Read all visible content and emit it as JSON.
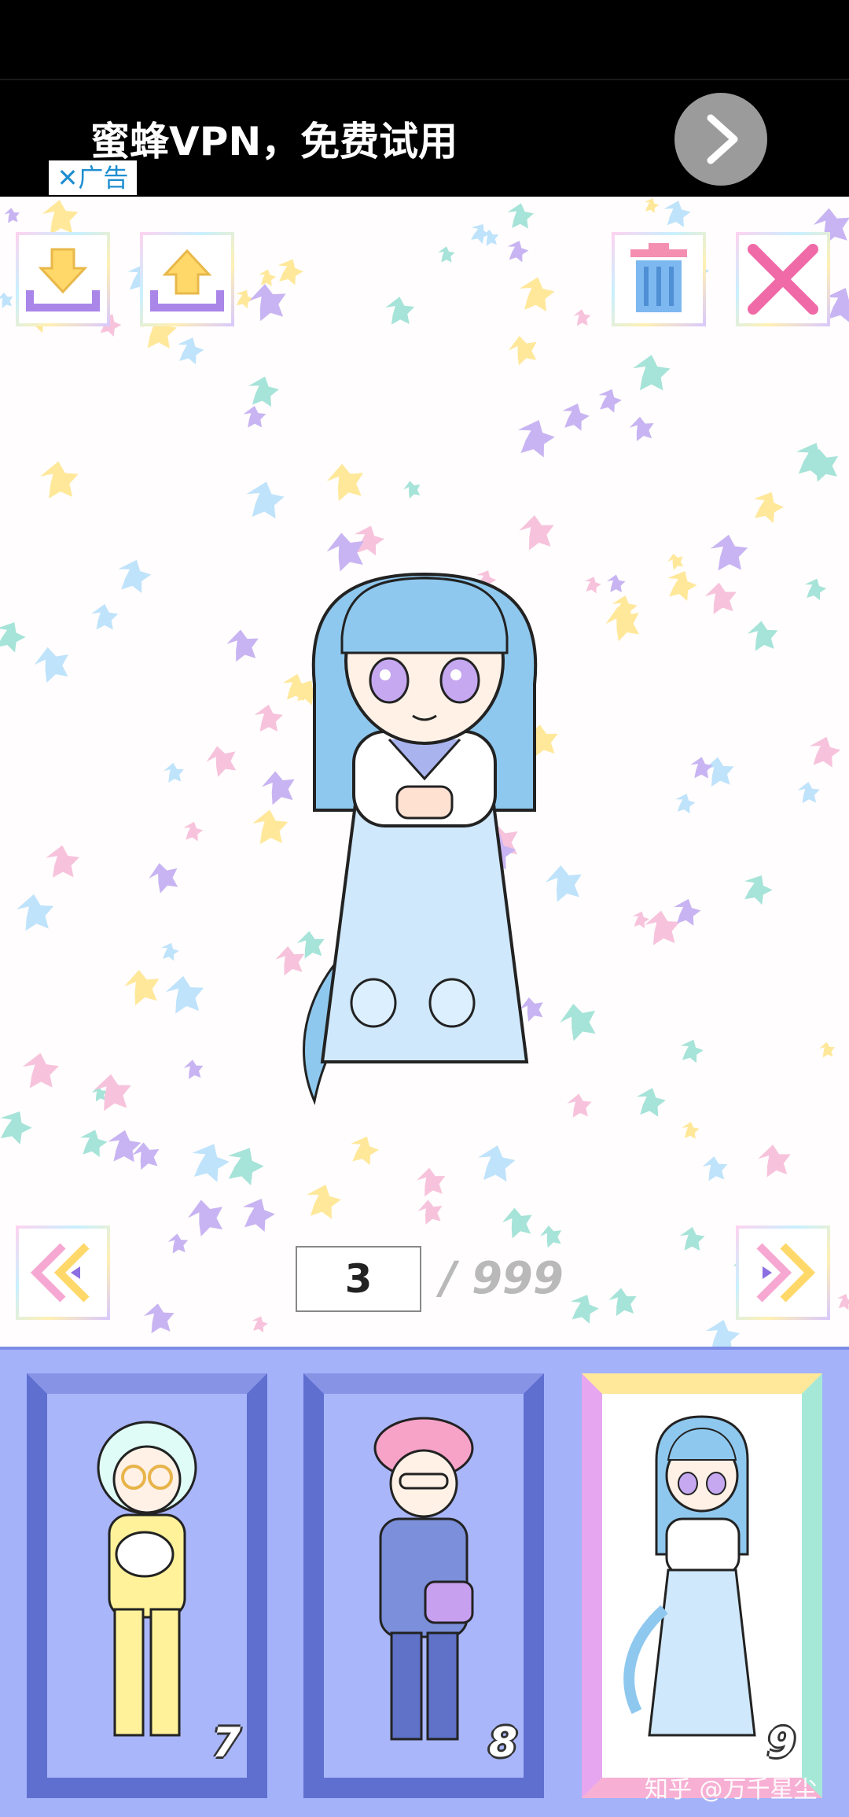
{
  "ad": {
    "text": "蜜蜂VPN，免费试用",
    "tag": "✕广告"
  },
  "toolbar": {
    "import_icon": "download-tray-icon",
    "export_icon": "upload-tray-icon",
    "delete_icon": "trash-icon",
    "close_icon": "close-icon"
  },
  "navigation": {
    "prev_icon": "double-chevron-left-icon",
    "next_icon": "double-chevron-right-icon",
    "current_page": "3",
    "total_pages": "/ 999"
  },
  "slots": [
    {
      "number": "7",
      "selected": false
    },
    {
      "number": "8",
      "selected": false
    },
    {
      "number": "9",
      "selected": true
    }
  ],
  "watermark": "知乎 @万千星尘",
  "colors": {
    "panel": "#a4b2f9",
    "frame": "#5f6fd0",
    "hair": "#8fc8ee",
    "dress": "#cfe8fb",
    "ad_button": "#9b9b9b"
  }
}
